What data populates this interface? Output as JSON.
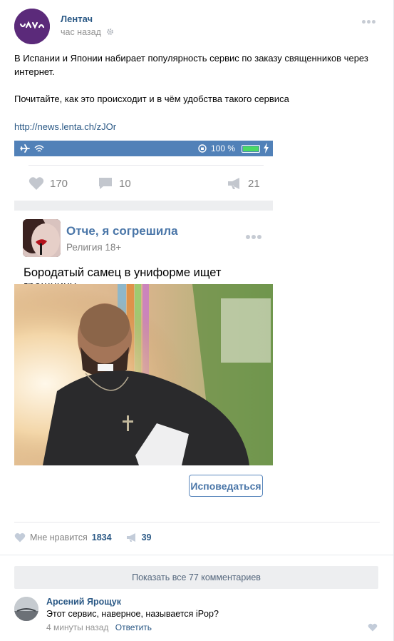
{
  "post": {
    "author": "Лентач",
    "time": "час назад",
    "text_p1": "В Испании и Японии набирает популярность сервис по заказу священников через интернет.",
    "text_p2": "Почитайте, как это происходит и в чём удобства такого сервиса",
    "link": "http://news.lenta.ch/zJOr"
  },
  "screenshot": {
    "battery_text": "100 %",
    "likes": "170",
    "comments": "10",
    "reposts": "21",
    "inner_title": "Отче, я согрешила",
    "inner_subtitle": "Религия 18+",
    "inner_text": "Бородатый самец в униформе ищет грешницу",
    "button_label": "Исповедаться"
  },
  "actions": {
    "like_label": "Мне нравится",
    "like_count": "1834",
    "share_count": "39"
  },
  "comments": {
    "show_all_label": "Показать все 77 комментариев",
    "items": [
      {
        "author": "Арсений Ярощук",
        "text": "Этот сервис, наверное, называется iPop?",
        "time": "4 минуты назад",
        "reply_label": "Ответить"
      }
    ]
  },
  "colors": {
    "link": "#2a5885",
    "accent": "#5181b8",
    "muted": "#939393"
  },
  "icons": [
    "gear-icon",
    "more-icon",
    "airplane-icon",
    "wifi-icon",
    "rotation-lock-icon",
    "battery-icon",
    "bolt-icon",
    "heart-icon",
    "comment-icon",
    "megaphone-icon"
  ]
}
